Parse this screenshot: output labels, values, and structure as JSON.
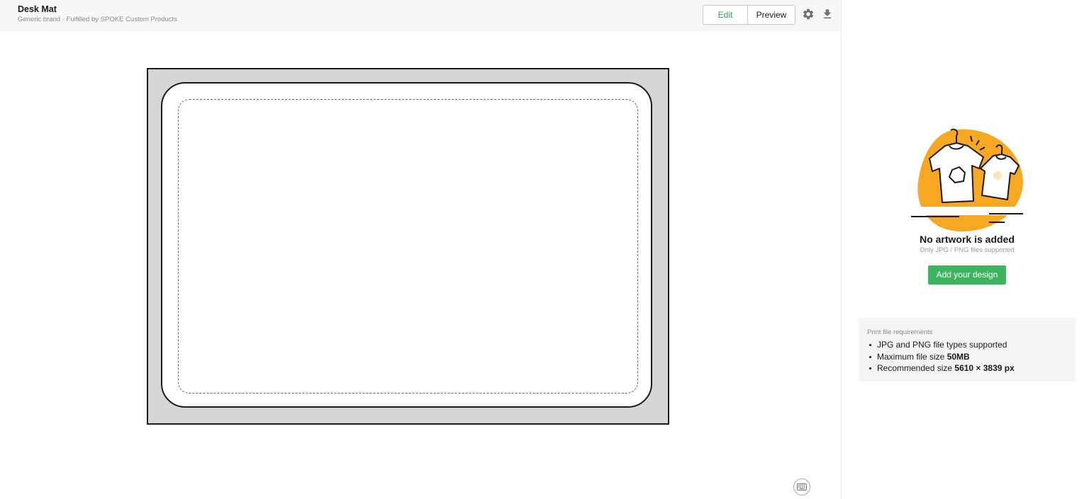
{
  "header": {
    "title": "Desk Mat",
    "subtitle": "Generic brand · Fulfilled by SPOKE Custom Products",
    "edit_label": "Edit",
    "preview_label": "Preview",
    "settings_icon": "gear-icon",
    "download_icon": "download-icon"
  },
  "canvas": {
    "mat_color": "#d6d6d6",
    "keyboard_icon": "keyboard-icon"
  },
  "sidebar": {
    "empty_title": "No artwork is added",
    "empty_subtitle": "Only JPG / PNG files supported",
    "add_button_label": "Add your design",
    "accent_color": "#3cb55e",
    "illustration_color": "#f7a823",
    "requirements": {
      "title": "Print file requirements",
      "item1": "JPG and PNG file types supported",
      "item2_prefix": "Maximum file size ",
      "item2_value": "50MB",
      "item3_prefix": "Recommended size ",
      "item3_value": "5610 × 3839 px"
    }
  }
}
